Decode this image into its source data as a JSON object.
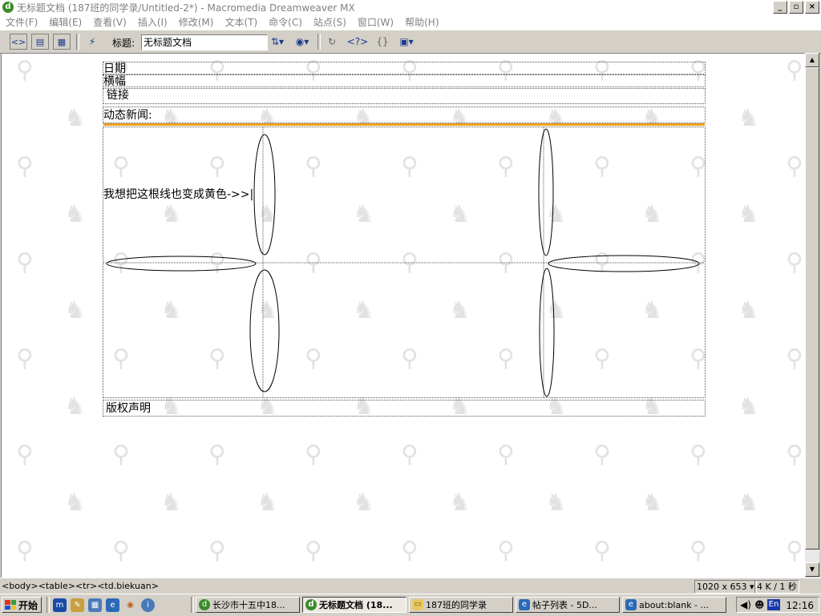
{
  "window": {
    "title": "无标题文档 (187班的同学录/Untitled-2*) - Macromedia Dreamweaver MX",
    "app_icon": "dreamweaver-icon",
    "controls": [
      "minimize",
      "maximize",
      "close"
    ]
  },
  "menu": [
    {
      "label": "文件(F)"
    },
    {
      "label": "编辑(E)"
    },
    {
      "label": "查看(V)"
    },
    {
      "label": "插入(I)"
    },
    {
      "label": "修改(M)"
    },
    {
      "label": "文本(T)"
    },
    {
      "label": "命令(C)"
    },
    {
      "label": "站点(S)"
    },
    {
      "label": "窗口(W)"
    },
    {
      "label": "帮助(H)"
    }
  ],
  "toolbar": {
    "title_label": "标题:",
    "title_value": "无标题文档",
    "buttons": [
      "code-view-icon",
      "split-view-icon",
      "design-view-icon",
      "live-data-icon",
      "file-management-icon",
      "preview-globe-icon",
      "refresh-icon",
      "reference-icon",
      "code-nav-icon",
      "view-options-icon"
    ]
  },
  "document": {
    "date_cell": "日期",
    "banner_cell": "横幅",
    "links_cell": "链接",
    "news_cell": "动态新闻:",
    "note_text": "我想把这根线也变成黄色->>|",
    "copyright_cell": "版权声明",
    "highlight_line_color": "#f0a020",
    "watermark_icon": "rabbit-watermark-icon"
  },
  "status": {
    "tag_path": "<body><table><tr><td.biekuan>",
    "window_size": "1020 x 653",
    "download": "4 K / 1 秒"
  },
  "taskbar": {
    "start_label": "开始",
    "quicklaunch": [
      "messenger-icon",
      "notepad-icon",
      "network-icon",
      "ie-icon",
      "media-player-icon",
      "info-icon"
    ],
    "tasks": [
      {
        "label": "长沙市十五中18...",
        "icon": "dreamweaver-icon"
      },
      {
        "label": "无标题文档 (18...",
        "icon": "dreamweaver-icon"
      },
      {
        "label": "187班的同学录",
        "icon": "folder-icon"
      },
      {
        "label": "帖子列表 - 5D...",
        "icon": "ie-icon"
      },
      {
        "label": "about:blank - ...",
        "icon": "ie-icon"
      }
    ],
    "tray": {
      "clock": "12:16",
      "lang": "En"
    }
  }
}
